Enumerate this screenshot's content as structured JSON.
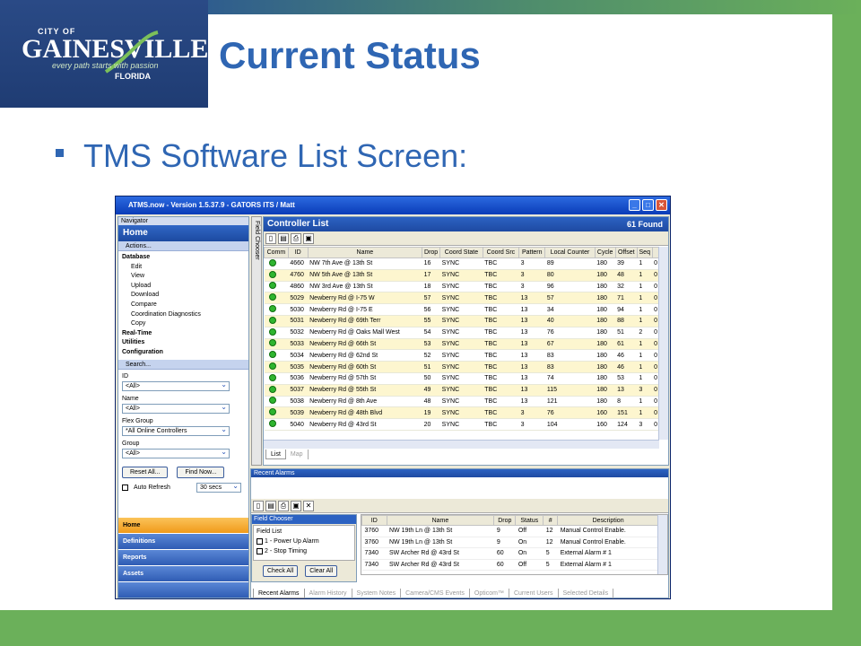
{
  "brand": {
    "city_of": "CITY OF",
    "name": "GAINESVILLE",
    "tagline": "every path starts with passion",
    "state": "FLORIDA",
    "colors": {
      "blue": "#1f3c73",
      "green": "#6bb05a",
      "title": "#2f66b3"
    }
  },
  "slide": {
    "title": "Current Status",
    "bullet": "TMS Software List Screen:"
  },
  "window": {
    "title": "ATMS.now - Version 1.5.37.9 - GATORS ITS / Matt",
    "buttons": {
      "minimize": "_",
      "maximize": "□",
      "close": "✕"
    }
  },
  "navigator": {
    "header": "Navigator",
    "home": "Home",
    "actions_label": "Actions...",
    "database": "Database",
    "database_items": [
      "Edit",
      "View",
      "Upload",
      "Download",
      "Compare",
      "Coordination Diagnostics",
      "Copy"
    ],
    "top_items": [
      "Real-Time",
      "Utilities",
      "Configuration"
    ],
    "search_label": "Search...",
    "fields": [
      {
        "label": "ID",
        "value": "<All>"
      },
      {
        "label": "Name",
        "value": "<All>"
      },
      {
        "label": "Flex Group",
        "value": "*All Online Controllers"
      },
      {
        "label": "Group",
        "value": "<All>"
      }
    ],
    "reset_button": "Reset All...",
    "find_button": "Find Now...",
    "auto_refresh": "Auto Refresh",
    "refresh_interval": "30 secs",
    "big_items": [
      "Home",
      "Definitions",
      "Reports",
      "Assets"
    ]
  },
  "field_chooser_tab": "Field Chooser",
  "controller_list": {
    "title": "Controller List",
    "count": "61 Found",
    "columns": [
      "Comm",
      "ID",
      "Name",
      "Drop",
      "Coord State",
      "Coord Src",
      "Pattern",
      "Local Counter",
      "Cycle",
      "Offset",
      "Seq"
    ],
    "rows": [
      [
        "",
        "4660",
        "NW 7th Ave @ 13th St",
        "16",
        "SYNC",
        "TBC",
        "3",
        "89",
        "180",
        "39",
        "1",
        "0"
      ],
      [
        "",
        "4760",
        "NW 5th Ave @ 13th St",
        "17",
        "SYNC",
        "TBC",
        "3",
        "80",
        "180",
        "48",
        "1",
        "0"
      ],
      [
        "",
        "4860",
        "NW 3rd Ave @ 13th St",
        "18",
        "SYNC",
        "TBC",
        "3",
        "96",
        "180",
        "32",
        "1",
        "0"
      ],
      [
        "",
        "5029",
        "Newberry Rd @ I-75 W",
        "57",
        "SYNC",
        "TBC",
        "13",
        "57",
        "180",
        "71",
        "1",
        "0"
      ],
      [
        "",
        "5030",
        "Newberry Rd @ I-75 E",
        "56",
        "SYNC",
        "TBC",
        "13",
        "34",
        "180",
        "94",
        "1",
        "0"
      ],
      [
        "",
        "5031",
        "Newberry Rd @ 69th Terr",
        "55",
        "SYNC",
        "TBC",
        "13",
        "40",
        "180",
        "88",
        "1",
        "0"
      ],
      [
        "",
        "5032",
        "Newberry Rd @ Oaks Mall West",
        "54",
        "SYNC",
        "TBC",
        "13",
        "76",
        "180",
        "51",
        "2",
        "0"
      ],
      [
        "",
        "5033",
        "Newberry Rd @ 66th St",
        "53",
        "SYNC",
        "TBC",
        "13",
        "67",
        "180",
        "61",
        "1",
        "0"
      ],
      [
        "",
        "5034",
        "Newberry Rd @ 62nd St",
        "52",
        "SYNC",
        "TBC",
        "13",
        "83",
        "180",
        "46",
        "1",
        "0"
      ],
      [
        "",
        "5035",
        "Newberry Rd @ 60th St",
        "51",
        "SYNC",
        "TBC",
        "13",
        "83",
        "180",
        "46",
        "1",
        "0"
      ],
      [
        "",
        "5036",
        "Newberry Rd @ 57th St",
        "50",
        "SYNC",
        "TBC",
        "13",
        "74",
        "180",
        "53",
        "1",
        "0"
      ],
      [
        "",
        "5037",
        "Newberry Rd @ 55th St",
        "49",
        "SYNC",
        "TBC",
        "13",
        "115",
        "180",
        "13",
        "3",
        "0"
      ],
      [
        "",
        "5038",
        "Newberry Rd @ 8th Ave",
        "48",
        "SYNC",
        "TBC",
        "13",
        "121",
        "180",
        "8",
        "1",
        "0"
      ],
      [
        "",
        "5039",
        "Newberry Rd @ 48th Blvd",
        "19",
        "SYNC",
        "TBC",
        "3",
        "76",
        "160",
        "151",
        "1",
        "0"
      ],
      [
        "",
        "5040",
        "Newberry Rd @ 43rd St",
        "20",
        "SYNC",
        "TBC",
        "3",
        "104",
        "160",
        "124",
        "3",
        "0"
      ]
    ],
    "tabs": [
      "List",
      "Map"
    ]
  },
  "recent_alarms": {
    "title": "Recent Alarms",
    "field_chooser": {
      "title": "Field Chooser",
      "list_label": "Field List",
      "items": [
        "1 - Power Up Alarm",
        "2 - Stop Timing"
      ],
      "check_all": "Check All",
      "clear_all": "Clear All"
    },
    "columns": [
      "ID",
      "Name",
      "Drop",
      "Status",
      "#",
      "Description"
    ],
    "rows": [
      [
        "3760",
        "NW 19th Ln @ 13th St",
        "9",
        "Off",
        "12",
        "Manual Control Enable."
      ],
      [
        "3760",
        "NW 19th Ln @ 13th St",
        "9",
        "On",
        "12",
        "Manual Control Enable."
      ],
      [
        "7340",
        "SW Archer Rd @ 43rd St",
        "60",
        "On",
        "5",
        "External Alarm # 1"
      ],
      [
        "7340",
        "SW Archer Rd @ 43rd St",
        "60",
        "Off",
        "5",
        "External Alarm # 1"
      ]
    ],
    "bottom_tabs": [
      "Recent Alarms",
      "Alarm History",
      "System Notes",
      "Camera/CMS Events",
      "Opticom™",
      "Current Users",
      "Selected Details"
    ]
  }
}
